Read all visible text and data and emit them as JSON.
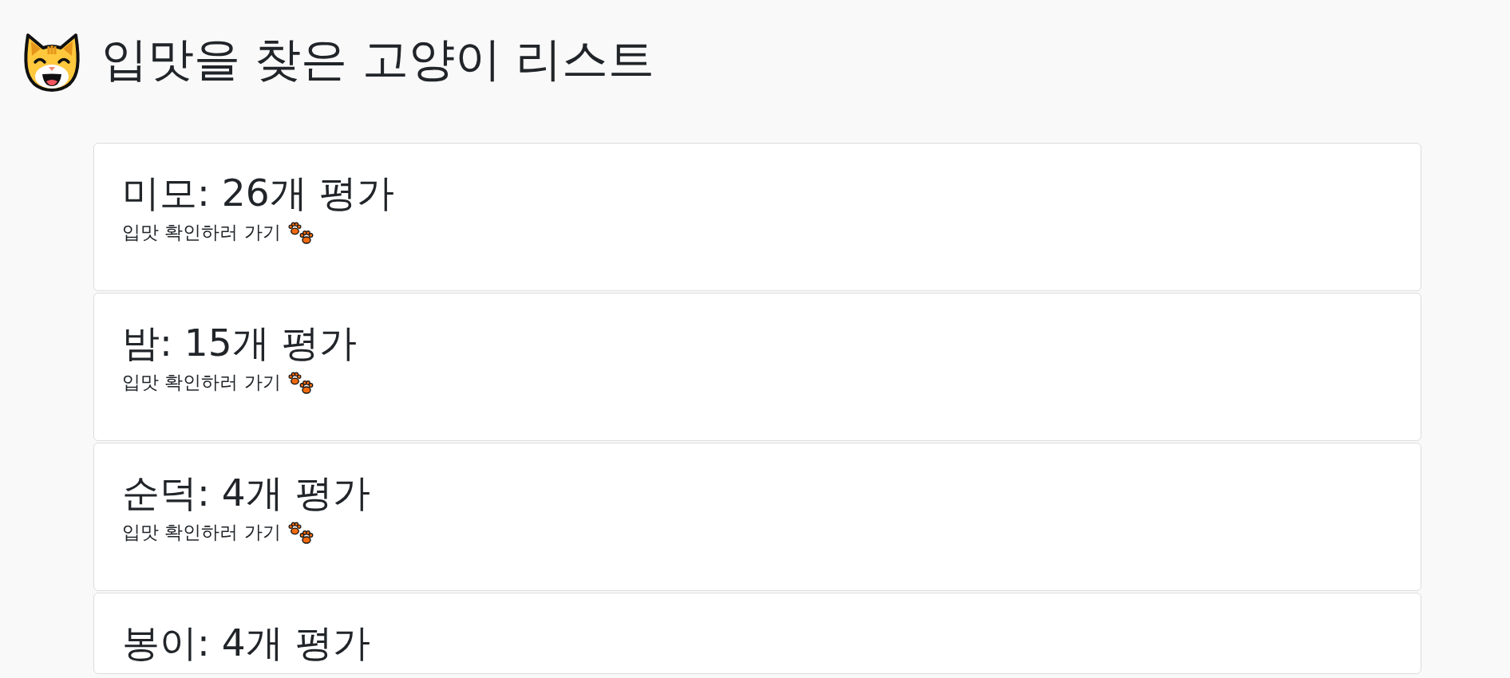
{
  "page_title": "입맛을 찾은 고양이 리스트",
  "cats": [
    {
      "heading": "미모: 26개 평가",
      "link": "입맛 확인하러 가기"
    },
    {
      "heading": "밤: 15개 평가",
      "link": "입맛 확인하러 가기"
    },
    {
      "heading": "순덕: 4개 평가",
      "link": "입맛 확인하러 가기"
    },
    {
      "heading": "봉이: 4개 평가"
    }
  ]
}
